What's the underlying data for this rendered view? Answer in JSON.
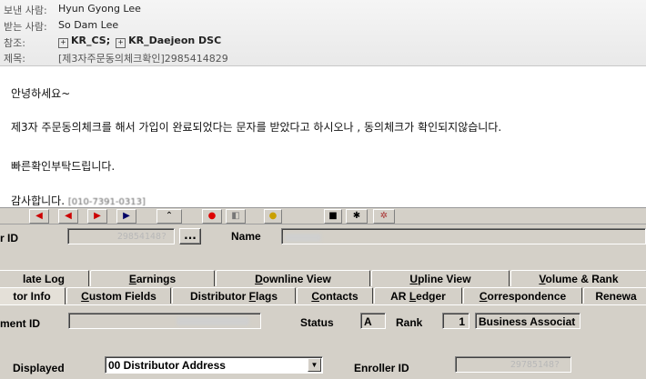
{
  "email": {
    "header": {
      "from_label": "보낸 사람:",
      "from_value": "Hyun Gyong Lee",
      "to_label": "받는 사람:",
      "to_value": "So Dam Lee",
      "cc_label": "참조:",
      "cc_recipients": [
        "KR_CS;",
        "KR_Daejeon DSC"
      ],
      "subject_label": "제목:",
      "subject_value": "[제3자주문동의체크확인]2985414829"
    },
    "body": {
      "greeting": "안녕하세요~",
      "line1": "제3자 주문동의체크를 해서 가입이 완료되었다는 문자를 받았다고 하시오나 , 동의체크가 확인되지않습니다.",
      "line2": "빠른확인부탁드립니다.",
      "closing": "감사합니다.",
      "phone": "[010-7391-0313]"
    }
  },
  "app": {
    "distributor_id_label": "r ID",
    "distributor_id_value": "29854148?",
    "lookup_button_label": "...",
    "name_label": "Name",
    "tabs_row1": [
      "late Log",
      "Earnings",
      "Downline View",
      "Upline View",
      "Volume & Rank"
    ],
    "tabs_row2": [
      "tor Info",
      "Custom Fields",
      "Distributor Flags",
      "Contacts",
      "AR Ledger",
      "Correspondence",
      "Renewa"
    ],
    "tabs_row2_underline": [
      "",
      "C",
      "F",
      "C",
      "L",
      "C",
      ""
    ],
    "tabs_row1_underline": [
      "",
      "E",
      "D",
      "U",
      "V"
    ],
    "shipment_id_label": "ment ID",
    "status_label": "Status",
    "status_value": "A",
    "rank_label": "Rank",
    "rank_value": "1",
    "rank_name": "Business Associat",
    "displayed_label": "Displayed",
    "address_select_value": "00 Distributor Address",
    "enroller_id_label": "Enroller ID",
    "enroller_id_value": "29785148?"
  }
}
